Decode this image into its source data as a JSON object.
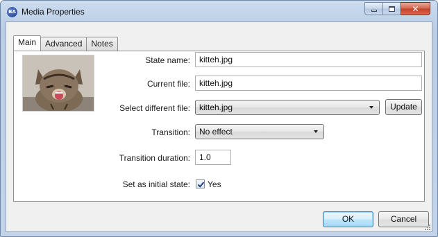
{
  "window": {
    "title": "Media Properties",
    "app_icon_text": "BA",
    "caption_buttons": {
      "minimize": "minimize-icon",
      "maximize": "maximize-icon",
      "close_glyph": "✕"
    }
  },
  "tabs": [
    {
      "label": "Main",
      "active": true
    },
    {
      "label": "Advanced",
      "active": false
    },
    {
      "label": "Notes",
      "active": false
    }
  ],
  "form": {
    "state_name_label": "State name:",
    "state_name_value": "kitteh.jpg",
    "current_file_label": "Current file:",
    "current_file_value": "kitteh.jpg",
    "select_file_label": "Select different file:",
    "select_file_value": "kitteh.jpg",
    "update_button": "Update",
    "transition_label": "Transition:",
    "transition_value": "No effect",
    "duration_label": "Transition duration:",
    "duration_value": "1.0",
    "initial_state_label": "Set as initial state:",
    "initial_state_checked": true,
    "initial_state_text": "Yes"
  },
  "footer": {
    "ok_label": "OK",
    "cancel_label": "Cancel"
  },
  "colors": {
    "frame": "#c3d4ea",
    "close_red": "#c2412a",
    "default_button": "#3c7fb1"
  }
}
